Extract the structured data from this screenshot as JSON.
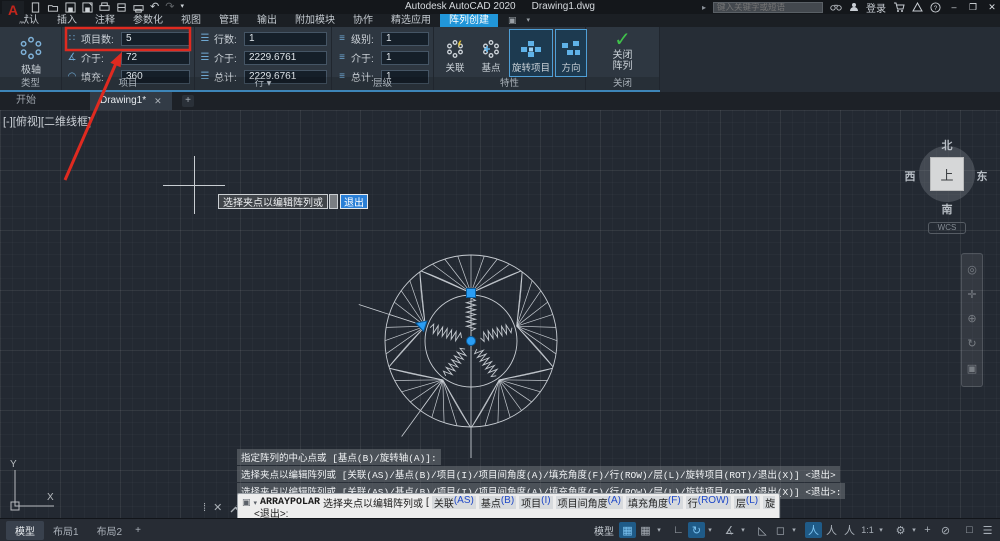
{
  "colors": {
    "accent": "#2196d9",
    "annotation_red": "#df2a20",
    "check_green": "#3fc24a",
    "grip_blue": "#2a9df4"
  },
  "icons": {
    "dots": "∷",
    "angle": "∡",
    "arc": "◠",
    "rows": "☰",
    "levels": "≡",
    "undo": "↶",
    "redo": "↷",
    "dropdown": "▾",
    "caret": "▸",
    "grid": "▦",
    "snap": "▦",
    "ortho": "∟",
    "polar": "↻",
    "isodraft": "∡",
    "osnap_tracking": "◺",
    "osnap": "◻",
    "person": "人",
    "gear": "⚙",
    "plus": "+",
    "isolate": "⊘",
    "clean": "□",
    "menu": "☰",
    "wheel": "◎",
    "pan": "✛",
    "zoom": "⊕",
    "orbit": "↻",
    "more": "▣",
    "handle": "⁞",
    "close_x": "✕",
    "dock_win": "▣"
  },
  "titlebar": {
    "app": "Autodesk AutoCAD 2020",
    "doc": "Drawing1.dwg",
    "search_placeholder": "键入关键字或短语",
    "signin": "登录",
    "min": "–",
    "max": "❐",
    "close": "✕"
  },
  "tabs": {
    "items": [
      "默认",
      "插入",
      "注释",
      "参数化",
      "视图",
      "管理",
      "输出",
      "附加模块",
      "协作",
      "精选应用"
    ],
    "active": "阵列创建"
  },
  "ribbon": {
    "type": {
      "button": "极轴",
      "label": "类型"
    },
    "items": {
      "rows": [
        {
          "label": "项目数:",
          "value": "5"
        },
        {
          "label": "介于:",
          "value": "72"
        },
        {
          "label": "填充:",
          "value": "360"
        }
      ],
      "label": "项目"
    },
    "rows": {
      "rows": [
        {
          "label": "行数:",
          "value": "1"
        },
        {
          "label": "介于:",
          "value": "2229.6761"
        },
        {
          "label": "总计:",
          "value": "2229.6761"
        }
      ],
      "label": "行 ▾"
    },
    "levels": {
      "rows": [
        {
          "label": "级别:",
          "value": "1"
        },
        {
          "label": "介于:",
          "value": "1"
        },
        {
          "label": "总计:",
          "value": "1"
        }
      ],
      "label": "层级"
    },
    "props": {
      "buttons": [
        "关联",
        "基点",
        "旋转项目",
        "方向"
      ],
      "label": "特性"
    },
    "close": {
      "button": "关闭阵列",
      "label": "关闭"
    }
  },
  "filetabs": {
    "start": "开始",
    "doc": "Drawing1*",
    "close": "✕",
    "new": "+"
  },
  "canvas": {
    "viewport_label": "[-][俯视][二维线框]",
    "tooltip": {
      "text": "选择夹点以编辑阵列或",
      "action": "退出"
    },
    "viewcube": {
      "n": "北",
      "s": "南",
      "e": "东",
      "w": "西",
      "top": "上",
      "wcs": "WCS"
    }
  },
  "cmd": {
    "history": [
      "指定阵列的中心点或 [基点(B)/旋转轴(A)]:",
      "选择夹点以编辑阵列或 [关联(AS)/基点(B)/项目(I)/项目间角度(A)/填充角度(F)/行(ROW)/层(L)/旋转项目(ROT)/退出(X)] <退出>",
      "选择夹点以编辑阵列或 [关联(AS)/基点(B)/项目(I)/项目间角度(A)/填充角度(F)/行(ROW)/层(L)/旋转项目(ROT)/退出(X)] <退出>:"
    ],
    "name": "ARRAYPOLAR",
    "prompt": "选择夹点以编辑阵列或",
    "open": "[",
    "options": [
      {
        "t": "关联",
        "c": "(AS)"
      },
      {
        "t": "基点",
        "c": "(B)"
      },
      {
        "t": "项目",
        "c": "(I)"
      },
      {
        "t": "项目间角度",
        "c": "(A)"
      },
      {
        "t": "填充角度",
        "c": "(F)"
      },
      {
        "t": "行",
        "c": "(ROW)"
      },
      {
        "t": "层",
        "c": "(L)"
      },
      {
        "t": "旋转项目",
        "c": "(ROT)"
      },
      {
        "t": "退出",
        "c": "(X)"
      }
    ],
    "prompt2": "<退出>:"
  },
  "statusbar": {
    "tabs": [
      "模型",
      "布局1",
      "布局2"
    ],
    "new_tab": "+",
    "model": "模型",
    "scale": "1:1"
  }
}
